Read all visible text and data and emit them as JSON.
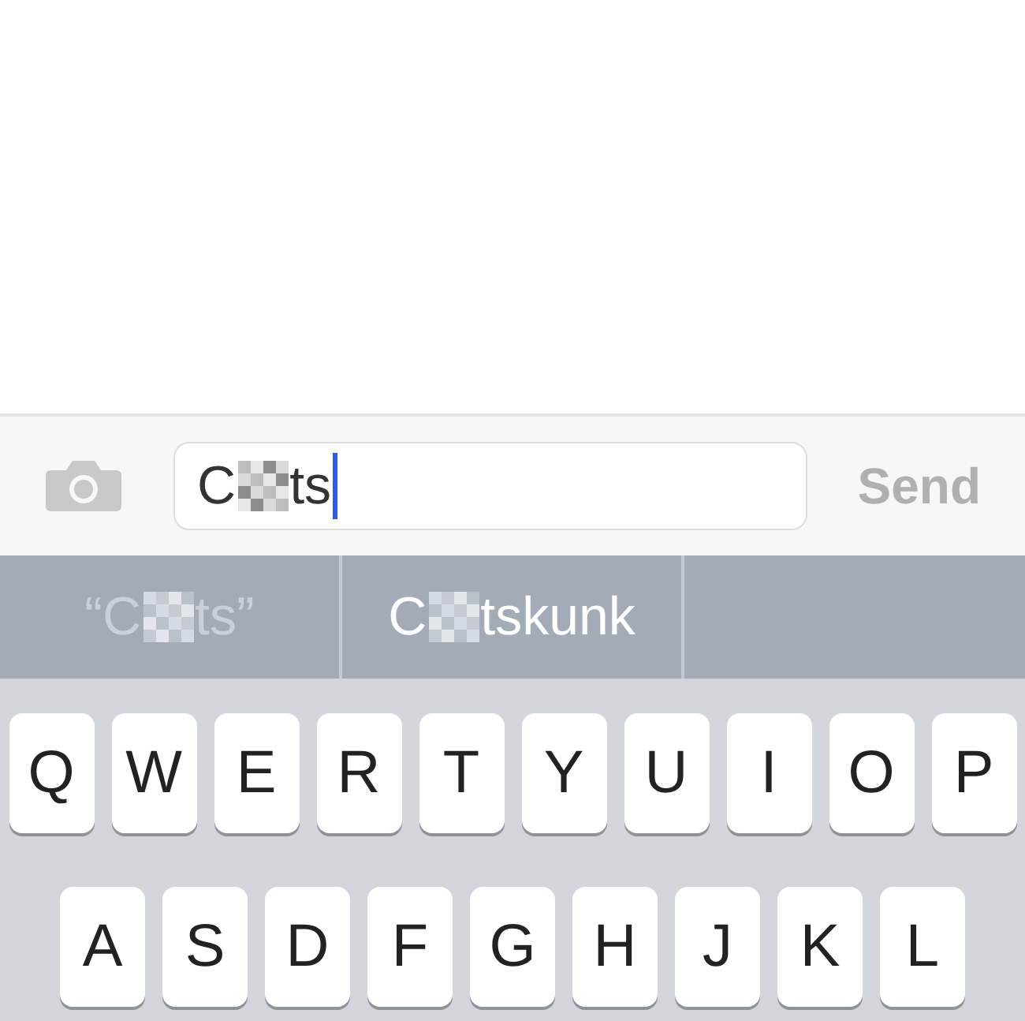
{
  "message_bar": {
    "field": {
      "before": "C",
      "after": "ts"
    },
    "send": {
      "label": "Send",
      "disabled": true
    }
  },
  "suggestions": [
    {
      "kind": "typed",
      "before": "“C",
      "after": "ts”"
    },
    {
      "kind": "word",
      "before": "C",
      "after": "tskunk"
    }
  ],
  "keyboard": {
    "rows": [
      [
        "Q",
        "W",
        "E",
        "R",
        "T",
        "Y",
        "U",
        "I",
        "O",
        "P"
      ],
      [
        "A",
        "S",
        "D",
        "F",
        "G",
        "H",
        "J",
        "K",
        "L"
      ]
    ]
  }
}
